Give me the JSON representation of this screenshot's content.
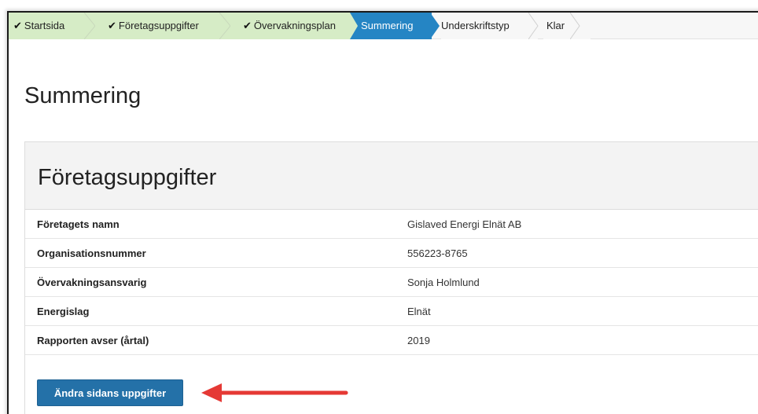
{
  "breadcrumb": [
    {
      "label": "Startsida",
      "state": "done"
    },
    {
      "label": "Företagsuppgifter",
      "state": "done"
    },
    {
      "label": "Övervakningsplan",
      "state": "done"
    },
    {
      "label": "Summering",
      "state": "active"
    },
    {
      "label": "Underskriftstyp",
      "state": "todo"
    },
    {
      "label": "Klar",
      "state": "todo"
    }
  ],
  "page": {
    "title": "Summering"
  },
  "panel": {
    "title": "Företagsuppgifter",
    "rows": [
      {
        "label": "Företagets namn",
        "value": "Gislaved Energi Elnät AB"
      },
      {
        "label": "Organisationsnummer",
        "value": "556223-8765"
      },
      {
        "label": "Övervakningsansvarig",
        "value": "Sonja Holmlund"
      },
      {
        "label": "Energislag",
        "value": "Elnät"
      },
      {
        "label": "Rapporten avser (årtal)",
        "value": "2019"
      }
    ],
    "edit_label": "Ändra sidans uppgifter"
  },
  "colors": {
    "done_step": "#d6ecc6",
    "active_step": "#2585c4",
    "button": "#2471a8",
    "annotation_arrow": "#e53935"
  },
  "icons": {
    "done_step": "checkmark-icon",
    "annotation": "red-arrow-icon"
  }
}
